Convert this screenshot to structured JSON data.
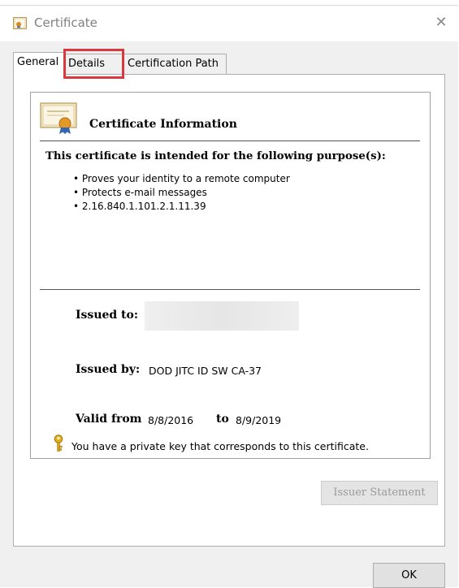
{
  "window": {
    "title": "Certificate",
    "close_glyph": "✕"
  },
  "tabs": [
    {
      "label": "General",
      "selected": true
    },
    {
      "label": "Details",
      "selected": false
    },
    {
      "label": "Certification Path",
      "selected": false
    }
  ],
  "annotation": {
    "highlight_color": "#d9383e",
    "highlighted_tab": "Details"
  },
  "general": {
    "heading": "Certificate Information",
    "purpose_heading": "This certificate is intended for the following purpose(s):",
    "purposes": [
      "Proves your identity to a remote computer",
      "Protects e-mail messages",
      "2.16.840.1.101.2.1.11.39"
    ],
    "issued_to_label": "Issued to:",
    "issued_to_value": "",
    "issued_by_label": "Issued by:",
    "issued_by_value": "DOD JITC ID SW CA-37",
    "valid_from_label": "Valid from",
    "valid_from_value": "8/8/2016",
    "valid_to_label": "to",
    "valid_to_value": "8/9/2019",
    "private_key_note": "You have a private key that corresponds to this certificate.",
    "issuer_statement_label": "Issuer Statement",
    "issuer_statement_enabled": false
  },
  "footer": {
    "ok_label": "OK"
  },
  "icons": {
    "title": "certificate-icon",
    "info": "certificate-document-icon",
    "key": "key-icon",
    "close": "close-icon"
  }
}
